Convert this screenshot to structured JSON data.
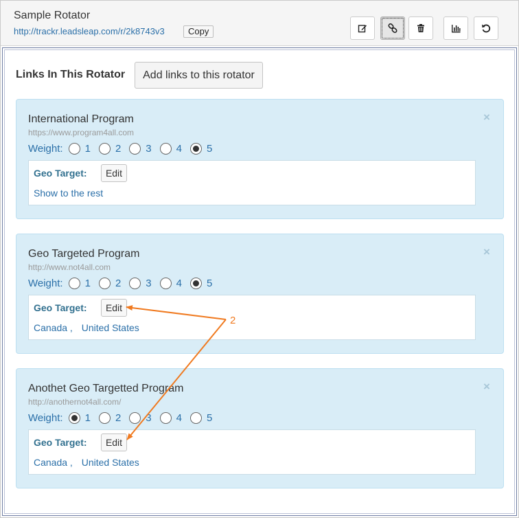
{
  "header": {
    "title": "Sample Rotator",
    "url": "http://trackr.leadsleap.com/r/2k8743v3",
    "copy_label": "Copy",
    "toolbar": [
      {
        "icon": "edit-icon"
      },
      {
        "icon": "link-icon",
        "active": true
      },
      {
        "icon": "trash-icon"
      },
      {
        "icon": "stats-icon"
      },
      {
        "icon": "reset-icon"
      }
    ]
  },
  "links_section": {
    "heading": "Links In This Rotator",
    "add_button_label": "Add links to this rotator"
  },
  "links": [
    {
      "name": "International Program",
      "url": "https://www.program4all.com",
      "weight_label": "Weight:",
      "weights": [
        "1",
        "2",
        "3",
        "4",
        "5"
      ],
      "selected_weight": "5",
      "geo_target_label": "Geo Target:",
      "edit_label": "Edit",
      "geo_countries": [
        "Show to the rest"
      ]
    },
    {
      "name": "Geo Targeted Program",
      "url": "http://www.not4all.com",
      "weight_label": "Weight:",
      "weights": [
        "1",
        "2",
        "3",
        "4",
        "5"
      ],
      "selected_weight": "5",
      "geo_target_label": "Geo Target:",
      "edit_label": "Edit",
      "geo_countries": [
        "Canada",
        "United States"
      ]
    },
    {
      "name": "Anothet Geo Targetted Program",
      "url": "http://anothernot4all.com/",
      "weight_label": "Weight:",
      "weights": [
        "1",
        "2",
        "3",
        "4",
        "5"
      ],
      "selected_weight": "1",
      "geo_target_label": "Geo Target:",
      "edit_label": "Edit",
      "geo_countries": [
        "Canada",
        "United States"
      ]
    }
  ],
  "annotation": {
    "number": "2",
    "color": "#f07a20"
  },
  "colors": {
    "card_bg": "#d9edf7",
    "link_blue": "#2a6fa8",
    "geo_label": "#31708f"
  }
}
